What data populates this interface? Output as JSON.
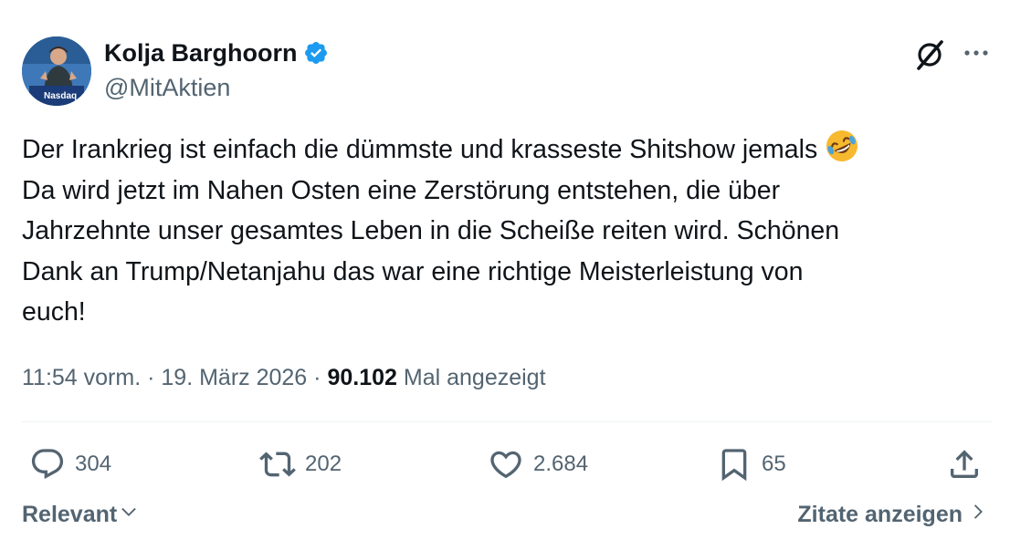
{
  "author": {
    "display_name": "Kolja Barghoorn",
    "handle": "@MitAktien",
    "avatar_caption": "Nasdaq",
    "verified": true,
    "verified_color": "#1d9bf0"
  },
  "tweet": {
    "lines": [
      "Der Irankrieg ist einfach die dümmste und krasseste Shitshow jemals",
      "Da wird jetzt im Nahen Osten eine Zerstörung entstehen, die über",
      "Jahrzehnte unser gesamtes Leben in die Scheiße reiten wird. Schönen",
      "Dank an Trump/Netanjahu das war eine richtige Meisterleistung von",
      "euch!"
    ],
    "emoji": "rolling-on-the-floor-laughing"
  },
  "meta": {
    "time": "11:54 vorm.",
    "separator": "·",
    "date": "19. März 2026",
    "views_count": "90.102",
    "views_label": "Mal angezeigt"
  },
  "actions": {
    "replies": "304",
    "reposts": "202",
    "likes": "2.684",
    "bookmarks": "65"
  },
  "footer": {
    "sort_label": "Relevant",
    "quotes_label": "Zitate anzeigen"
  },
  "colors": {
    "text": "#0f1419",
    "secondary": "#536471",
    "divider": "#eff3f4"
  }
}
